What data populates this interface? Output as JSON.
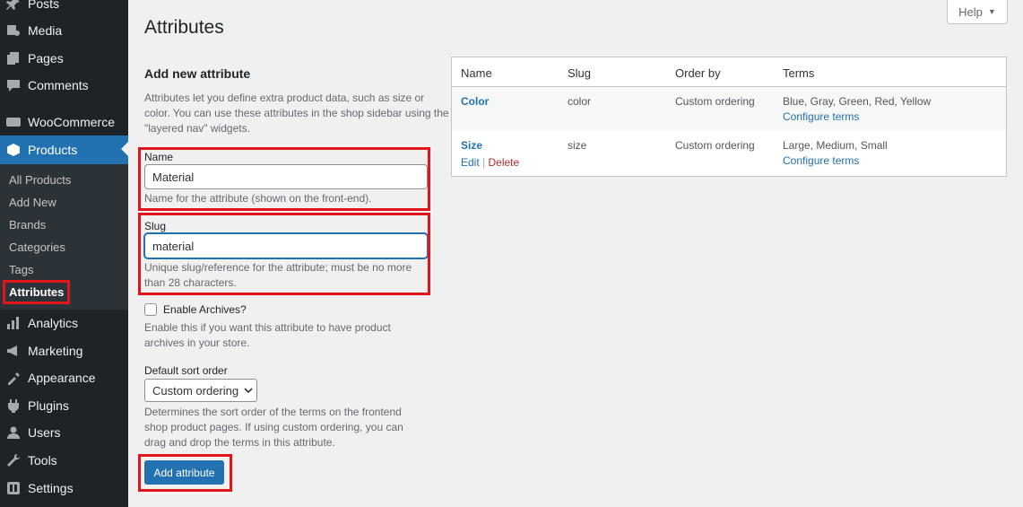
{
  "sidebar": {
    "items": [
      {
        "label": "Posts",
        "icon": "pin-icon"
      },
      {
        "label": "Media",
        "icon": "media-icon"
      },
      {
        "label": "Pages",
        "icon": "pages-icon"
      },
      {
        "label": "Comments",
        "icon": "comments-icon"
      },
      {
        "label": "WooCommerce",
        "icon": "woocommerce-icon"
      },
      {
        "label": "Products",
        "icon": "products-icon"
      },
      {
        "label": "Analytics",
        "icon": "analytics-icon"
      },
      {
        "label": "Marketing",
        "icon": "marketing-icon"
      },
      {
        "label": "Appearance",
        "icon": "appearance-icon"
      },
      {
        "label": "Plugins",
        "icon": "plugins-icon"
      },
      {
        "label": "Users",
        "icon": "users-icon"
      },
      {
        "label": "Tools",
        "icon": "tools-icon"
      },
      {
        "label": "Settings",
        "icon": "settings-icon"
      }
    ],
    "submenu": [
      "All Products",
      "Add New",
      "Brands",
      "Categories",
      "Tags",
      "Attributes"
    ]
  },
  "header": {
    "title": "Attributes",
    "help_label": "Help"
  },
  "form": {
    "title": "Add new attribute",
    "intro": "Attributes let you define extra product data, such as size or color. You can use these attributes in the shop sidebar using the \"layered nav\" widgets.",
    "name_label": "Name",
    "name_value": "Material",
    "name_desc": "Name for the attribute (shown on the front-end).",
    "slug_label": "Slug",
    "slug_value": "material",
    "slug_desc": "Unique slug/reference for the attribute; must be no more than 28 characters.",
    "archives_label": "Enable Archives?",
    "archives_checked": false,
    "archives_desc": "Enable this if you want this attribute to have product archives in your store.",
    "sort_label": "Default sort order",
    "sort_value": "Custom ordering",
    "sort_desc": "Determines the sort order of the terms on the frontend shop product pages. If using custom ordering, you can drag and drop the terms in this attribute.",
    "submit_label": "Add attribute"
  },
  "table": {
    "headers": [
      "Name",
      "Slug",
      "Order by",
      "Terms"
    ],
    "rows": [
      {
        "name": "Color",
        "slug": "color",
        "order_by": "Custom ordering",
        "terms": "Blue, Gray, Green, Red, Yellow",
        "configure": "Configure terms"
      },
      {
        "name": "Size",
        "slug": "size",
        "order_by": "Custom ordering",
        "terms": "Large, Medium, Small",
        "configure": "Configure terms",
        "edit": "Edit",
        "delete": "Delete"
      }
    ]
  },
  "colors": {
    "sidebar_bg": "#1d2327",
    "accent": "#2271b1",
    "highlight": "#e0161b",
    "delete": "#b32d2e"
  }
}
